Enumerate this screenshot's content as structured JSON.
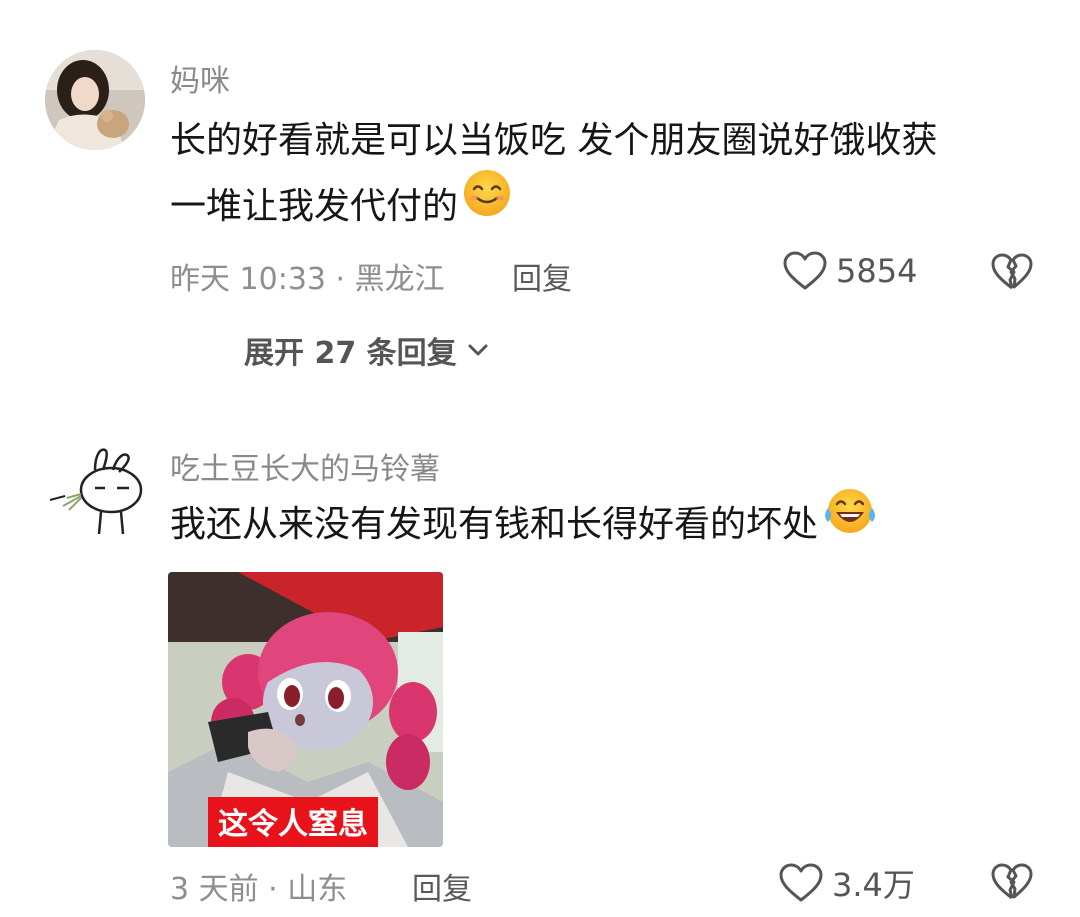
{
  "comments": [
    {
      "username": "妈咪",
      "text_line1": "长的好看就是可以当饭吃 发个朋友圈说好饿收获",
      "text_line2": "一堆让我发代付的",
      "emoji_icon": "smiling-face-icon",
      "time_location": "昨天 10:33 · 黑龙江",
      "reply_label": "回复",
      "like_count": "5854",
      "expand_label": "展开 27 条回复"
    },
    {
      "username": "吃土豆长大的马铃薯",
      "text_line1": "我还从来没有发现有钱和长得好看的坏处",
      "emoji_icon": "tears-of-joy-icon",
      "sticker_caption": "这令人窒息",
      "time_location": "3 天前 · 山东",
      "reply_label": "回复",
      "like_count": "3.4万"
    }
  ],
  "colors": {
    "username": "#8a8a8a",
    "content": "#161616",
    "meta": "#8e8e8e",
    "caption_bg": "#e8121a"
  }
}
